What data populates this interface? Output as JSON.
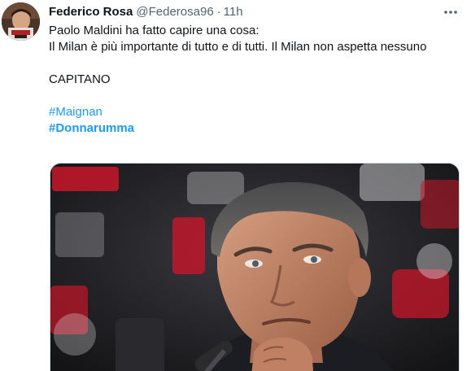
{
  "tweet": {
    "display_name": "Federico Rosa",
    "handle": "@Federosa96",
    "separator": "·",
    "time": "11h",
    "more_icon": "ellipsis-icon",
    "lines": [
      "Paolo Maldini ha fatto capire una cosa:",
      "Il Milan è più importante di tutto e di tutti. Il Milan non aspetta nessuno",
      "CAPITANO"
    ],
    "hashtags": [
      "#Maignan",
      "#Donnarumma"
    ]
  },
  "media": {
    "description_icon": "press-conference-photo",
    "colors": {
      "backdrop": "#1c1c1f",
      "red_panel": "#c8162a",
      "skin": "#c48a6a"
    }
  },
  "colors": {
    "link": "#1d9bf0",
    "secondary_text": "#536471",
    "primary_text": "#0f1419",
    "border": "#cfd9de"
  }
}
